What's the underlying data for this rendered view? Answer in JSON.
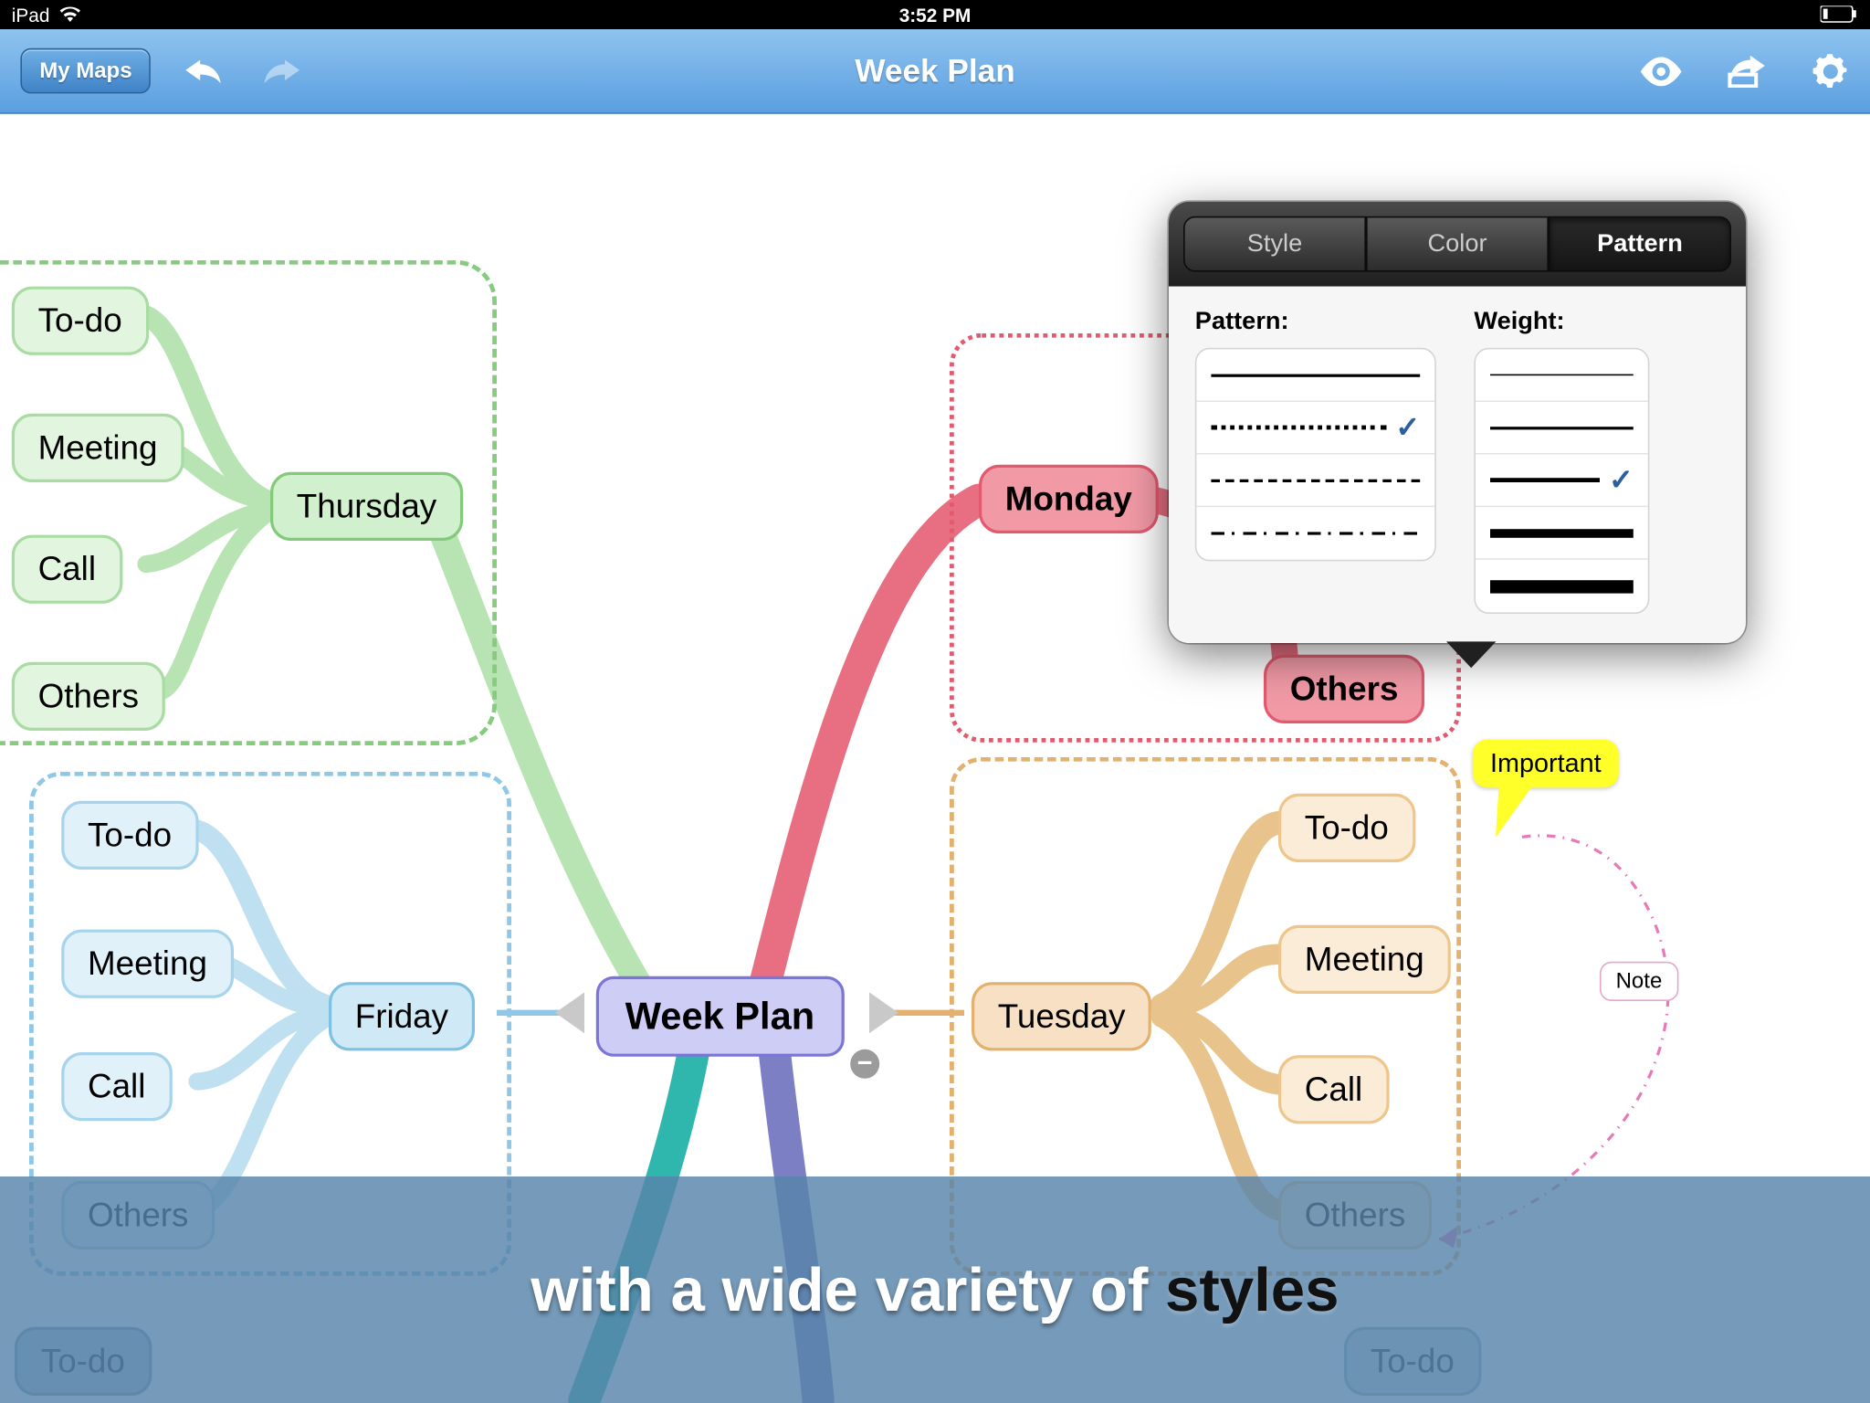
{
  "status": {
    "device": "iPad",
    "time": "3:52 PM"
  },
  "toolbar": {
    "my_maps": "My Maps",
    "title": "Week Plan"
  },
  "center_node": "Week Plan",
  "days": {
    "monday": {
      "label": "Monday",
      "children": [
        "Others"
      ]
    },
    "tuesday": {
      "label": "Tuesday",
      "children": [
        "To-do",
        "Meeting",
        "Call",
        "Others"
      ]
    },
    "thursday": {
      "label": "Thursday",
      "children": [
        "To-do",
        "Meeting",
        "Call",
        "Others"
      ]
    },
    "friday": {
      "label": "Friday",
      "children": [
        "To-do",
        "Meeting",
        "Call",
        "Others"
      ]
    }
  },
  "annotations": {
    "important": "Important",
    "note": "Note"
  },
  "partial_below": {
    "left": "To-do",
    "right": "To-do"
  },
  "popover": {
    "tabs": [
      "Style",
      "Color",
      "Pattern"
    ],
    "active_tab": 2,
    "col1_label": "Pattern:",
    "col2_label": "Weight:",
    "pattern_selected": 1,
    "weight_selected": 2
  },
  "caption": {
    "pre": "with a wide variety of ",
    "bold": "styles"
  }
}
